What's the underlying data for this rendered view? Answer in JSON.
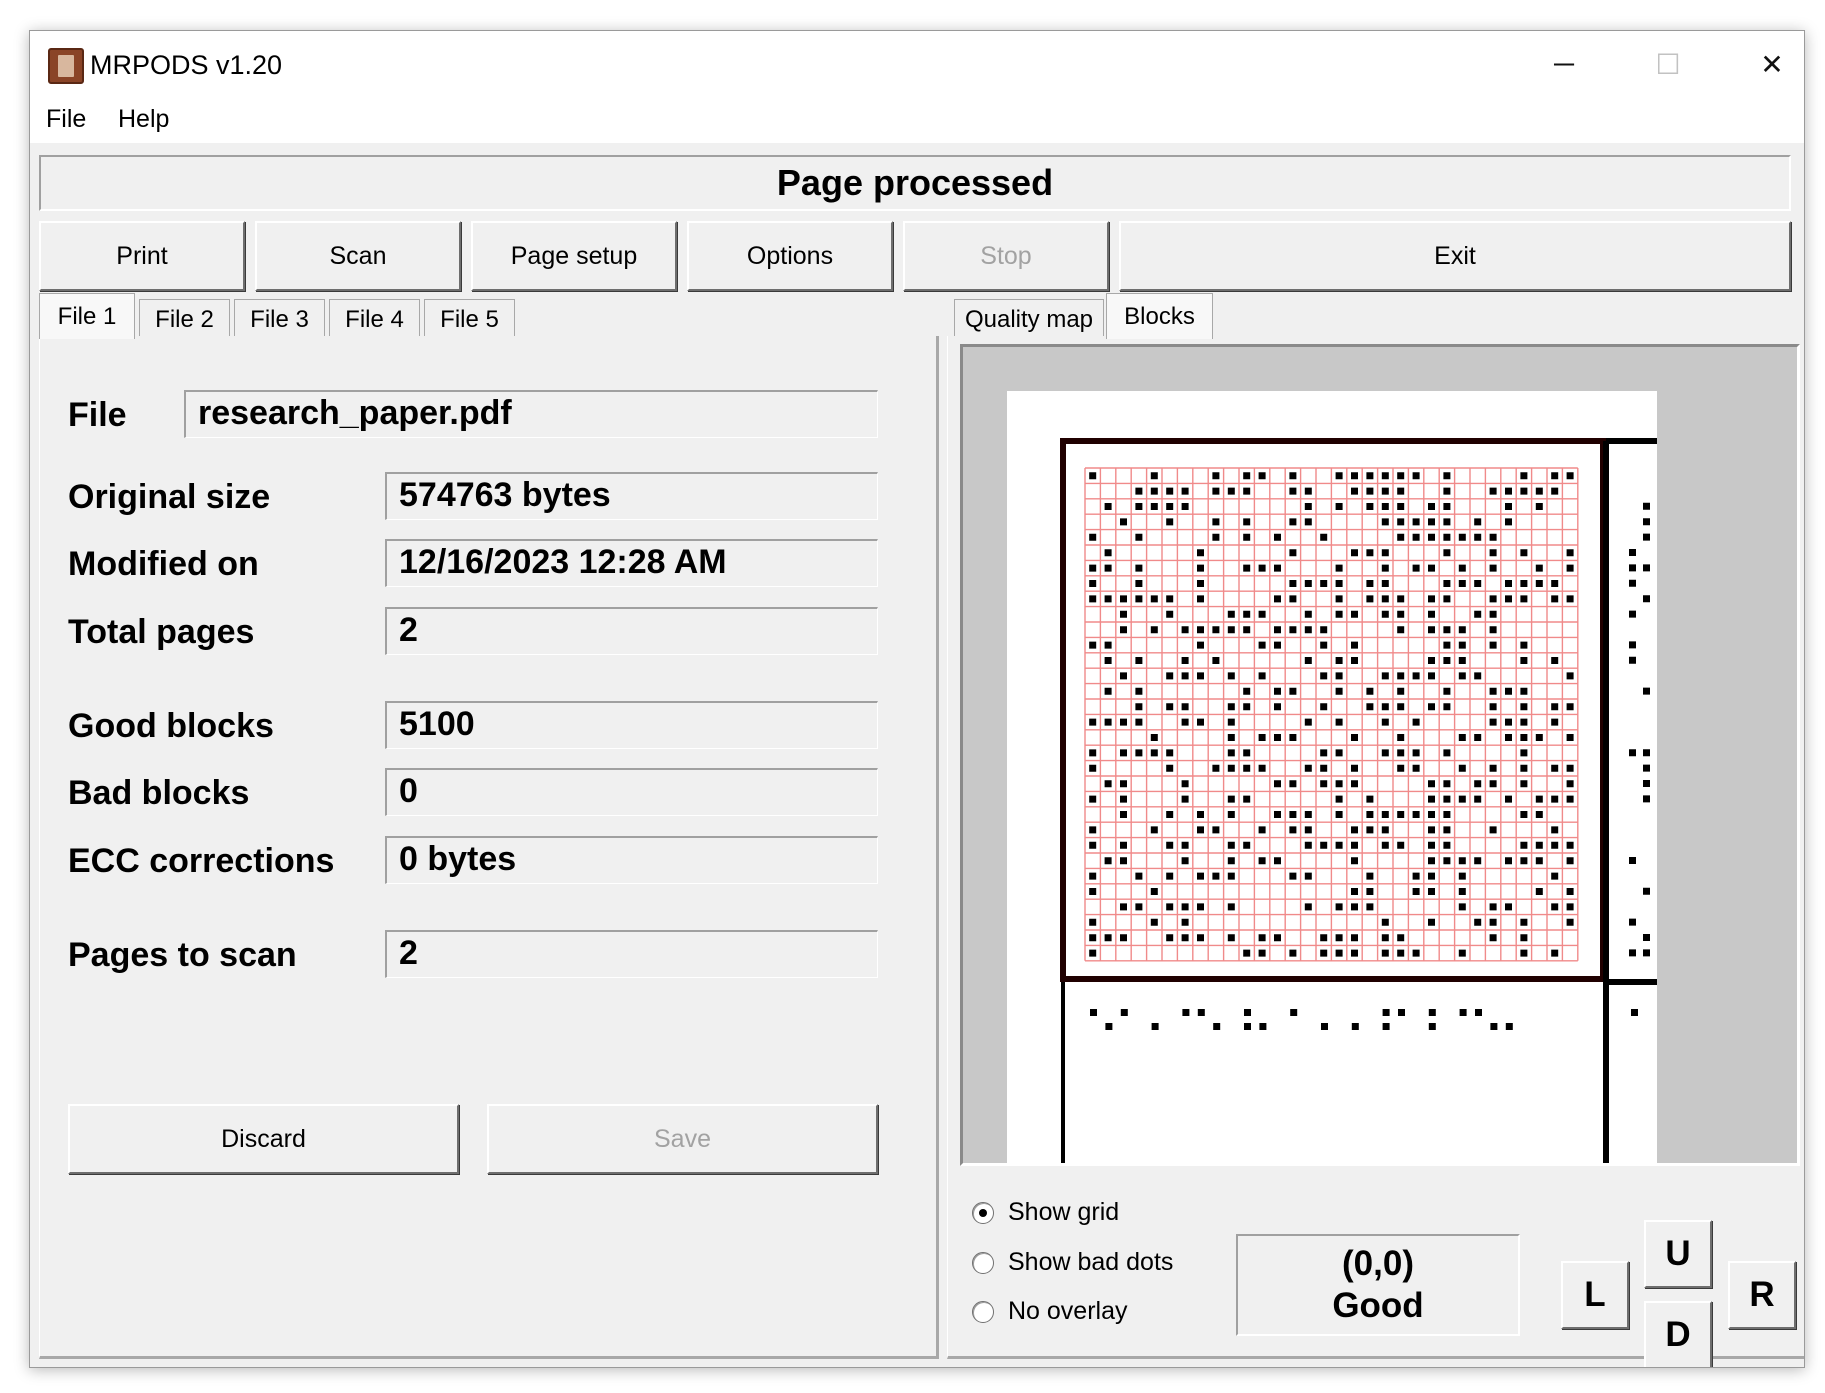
{
  "window": {
    "title": "MRPODS v1.20",
    "controls": {
      "minimize": "─",
      "maximize": "☐",
      "close": "✕"
    }
  },
  "menu": {
    "file": "File",
    "help": "Help"
  },
  "status": "Page processed",
  "toolbar": {
    "print": "Print",
    "scan": "Scan",
    "page_setup": "Page setup",
    "options": "Options",
    "stop": "Stop",
    "exit": "Exit"
  },
  "file_tabs": [
    "File 1",
    "File 2",
    "File 3",
    "File 4",
    "File 5"
  ],
  "file_info": {
    "file_label": "File",
    "file_value": "research_paper.pdf",
    "original_size_label": "Original size",
    "original_size_value": "574763 bytes",
    "modified_on_label": "Modified on",
    "modified_on_value": "12/16/2023 12:28 AM",
    "total_pages_label": "Total pages",
    "total_pages_value": "2",
    "good_blocks_label": "Good blocks",
    "good_blocks_value": "5100",
    "bad_blocks_label": "Bad blocks",
    "bad_blocks_value": "0",
    "ecc_label": "ECC corrections",
    "ecc_value": "0 bytes",
    "pages_to_scan_label": "Pages to scan",
    "pages_to_scan_value": "2"
  },
  "actions": {
    "discard": "Discard",
    "save": "Save"
  },
  "view_tabs": {
    "quality_map": "Quality map",
    "blocks": "Blocks"
  },
  "overlay_options": {
    "show_grid": "Show grid",
    "show_bad_dots": "Show bad dots",
    "no_overlay": "No overlay",
    "selected": "show_grid"
  },
  "block_status": {
    "coords": "(0,0)",
    "state": "Good"
  },
  "nav": {
    "up": "U",
    "left": "L",
    "down": "D",
    "right": "R"
  },
  "colors": {
    "grid_line": "#f08a8a",
    "block_border": "#200000",
    "dot": "#000000"
  }
}
